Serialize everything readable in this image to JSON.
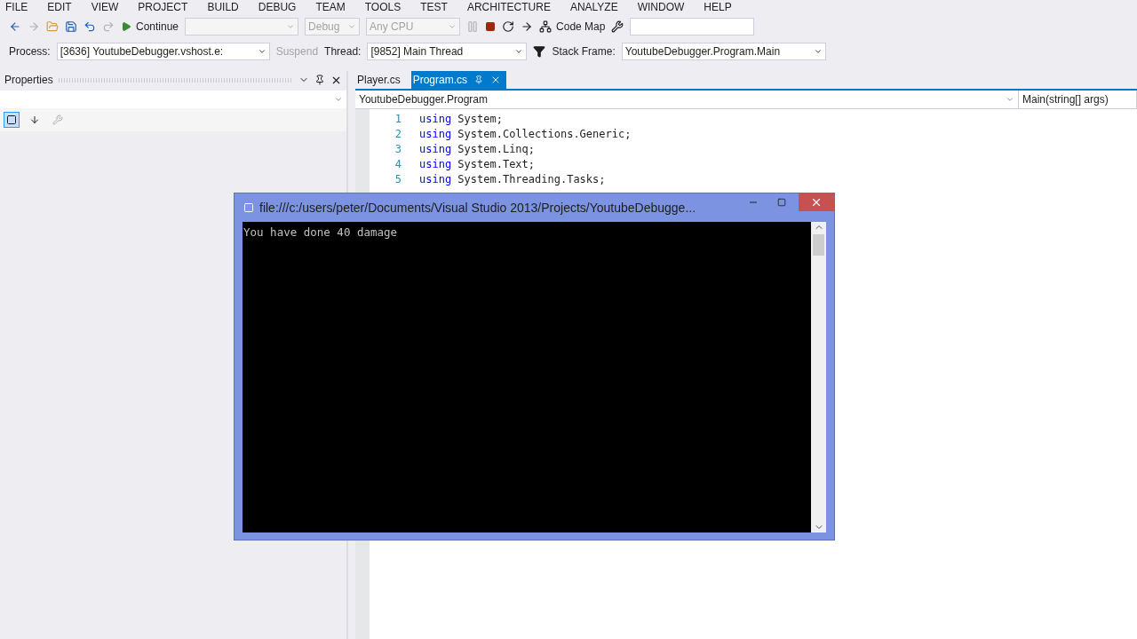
{
  "menu": [
    "FILE",
    "EDIT",
    "VIEW",
    "PROJECT",
    "BUILD",
    "DEBUG",
    "TEAM",
    "TOOLS",
    "TEST",
    "ARCHITECTURE",
    "ANALYZE",
    "WINDOW",
    "HELP"
  ],
  "toolbar": {
    "continue": "Continue",
    "config": {
      "value": "Debug",
      "disabled": true
    },
    "platform": {
      "value": "Any CPU",
      "disabled": true
    },
    "code_map": "Code Map"
  },
  "debug_bar": {
    "process_label": "Process:",
    "process": "[3636] YoutubeDebugger.vshost.e:",
    "suspend": {
      "label": "Suspend",
      "disabled": true
    },
    "thread_label": "Thread:",
    "thread": "[9852] Main Thread",
    "stack_label": "Stack Frame:",
    "stack": "YoutubeDebugger.Program.Main"
  },
  "properties": {
    "title": "Properties"
  },
  "tabs": [
    {
      "label": "Player.cs",
      "selected": false
    },
    {
      "label": "Program.cs",
      "selected": true
    }
  ],
  "nav": {
    "type": "YoutubeDebugger.Program",
    "member": "Main(string[] args)"
  },
  "code": [
    {
      "number": "1",
      "keyword": "using",
      "text": " System;"
    },
    {
      "number": "2",
      "keyword": "using",
      "text": " System.Collections.Generic;"
    },
    {
      "number": "3",
      "keyword": "using",
      "text": " System.Linq;"
    },
    {
      "number": "4",
      "keyword": "using",
      "text": " System.Text;"
    },
    {
      "number": "5",
      "keyword": "using",
      "text": " System.Threading.Tasks;"
    }
  ],
  "console": {
    "title": "file:///c:/users/peter/Documents/Visual Studio 2013/Projects/YoutubeDebugge...",
    "output": "You have done 40 damage"
  }
}
